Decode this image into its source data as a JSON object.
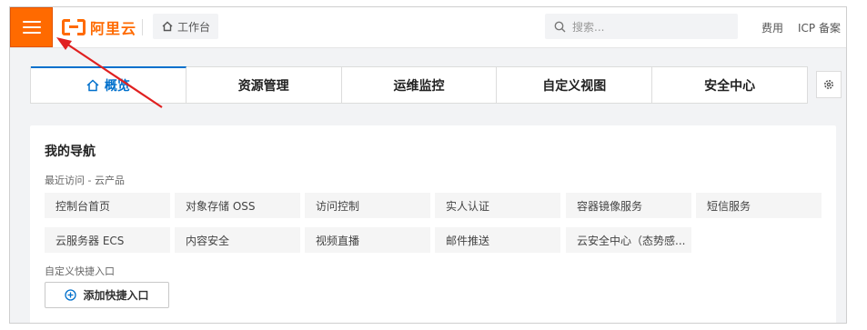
{
  "colors": {
    "brand": "#ff6a00",
    "active_tab": "#0070cc",
    "annotation": "#e02020"
  },
  "header": {
    "menu_icon": "hamburger-menu-icon",
    "logo_text": "阿里云",
    "workbench_label": "工作台",
    "search_placeholder": "搜索...",
    "links": {
      "fee": "费用",
      "icp": "ICP 备案"
    }
  },
  "tabs": [
    {
      "label": "概览",
      "active": true,
      "icon": "home-icon"
    },
    {
      "label": "资源管理",
      "active": false
    },
    {
      "label": "运维监控",
      "active": false
    },
    {
      "label": "自定义视图",
      "active": false
    },
    {
      "label": "安全中心",
      "active": false
    }
  ],
  "settings_icon": "gear-icon",
  "nav": {
    "title": "我的导航",
    "recent_label": "最近访问 - 云产品",
    "recent_items": [
      "控制台首页",
      "对象存储 OSS",
      "访问控制",
      "实人认证",
      "容器镜像服务",
      "短信服务",
      "云服务器 ECS",
      "内容安全",
      "视频直播",
      "邮件推送",
      "云安全中心（态势感..."
    ],
    "custom_label": "自定义快捷入口",
    "add_button": "添加快捷入口"
  }
}
